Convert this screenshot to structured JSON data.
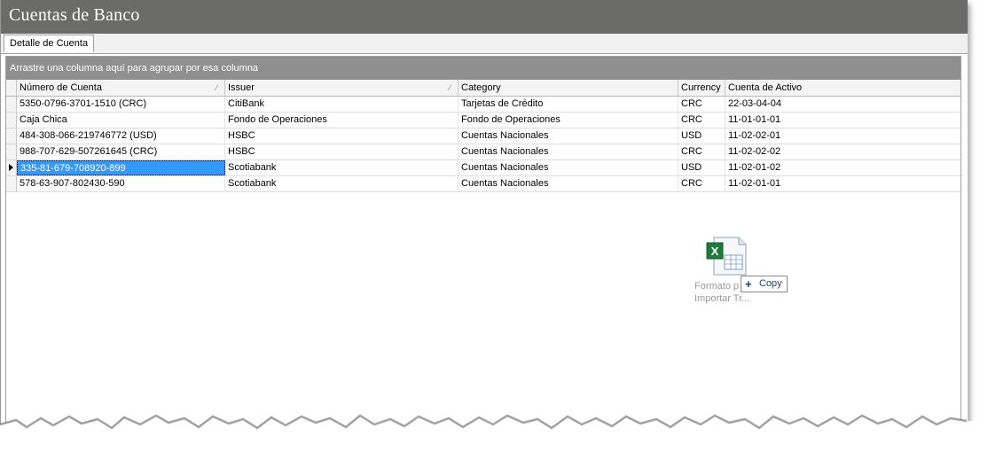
{
  "window": {
    "title": "Cuentas de Banco"
  },
  "tabs": [
    {
      "label": "Detalle de Cuenta"
    }
  ],
  "grid": {
    "group_hint": "Arrastre una columna aquí para agrupar por esa columna",
    "columns": [
      "Número de Cuenta",
      "Issuer",
      "Category",
      "Currency",
      "Cuenta de Activo"
    ],
    "rows": [
      [
        "5350-0796-3701-1510 (CRC)",
        "CitiBank",
        "Tarjetas de Crédito",
        "CRC",
        "22-03-04-04"
      ],
      [
        "Caja Chica",
        "Fondo de Operaciones",
        "Fondo de Operaciones",
        "CRC",
        "11-01-01-01"
      ],
      [
        "484-308-066-219746772 (USD)",
        "HSBC",
        "Cuentas Nacionales",
        "USD",
        "11-02-02-01"
      ],
      [
        "988-707-629-507261645 (CRC)",
        "HSBC",
        "Cuentas Nacionales",
        "CRC",
        "11-02-02-02"
      ],
      [
        "335-81-679-708920-899",
        "Scotiabank",
        "Cuentas Nacionales",
        "USD",
        "11-02-01-02"
      ],
      [
        "578-63-907-802430-590",
        "Scotiabank",
        "Cuentas Nacionales",
        "CRC",
        "11-02-01-01"
      ]
    ],
    "selected_row": 4
  },
  "drag": {
    "file_icon": "excel-file-icon",
    "file_label_line1": "Formato p",
    "file_label_line2": "Importar Tr...",
    "copy_label": "Copy"
  },
  "colors": {
    "titlebar": "#6b6b69",
    "groupbar": "#8f8f8f",
    "selection": "#3399ff"
  }
}
